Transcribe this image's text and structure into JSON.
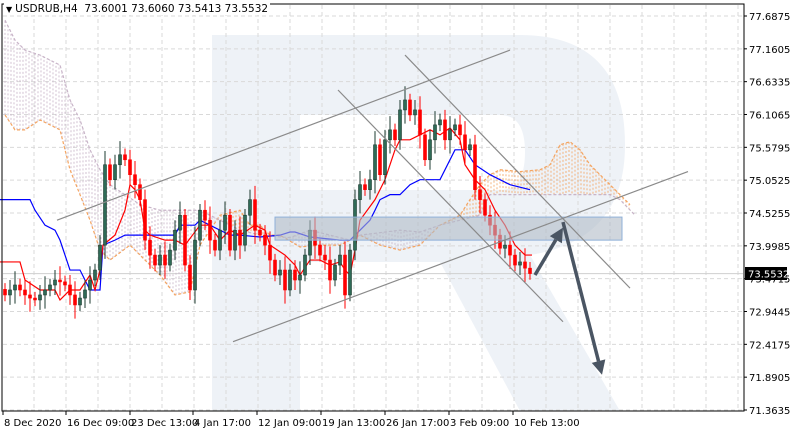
{
  "header": {
    "symbol": "USDRUB,H4",
    "ohlc": "73.6001 73.6060 73.5413 73.5532",
    "menu_icon": "triangle-down-icon"
  },
  "colors": {
    "bull": "#2f6b57",
    "bear": "#ff0000",
    "tenkan": "#ff0000",
    "kijun": "#0000ff",
    "span_a": "#f4a460",
    "span_b": "#c8b4c8",
    "grid": "#d9d9d9",
    "drawing": "#8a8a8a",
    "arrow": "#4a5563",
    "zone": "#b0bac6",
    "price_tag": "#000000"
  },
  "chart_data": {
    "type": "candlestick",
    "title": "USDRUB,H4",
    "ylim": [
      71.3635,
      77.6875
    ],
    "y_ticks": [
      "77.6875",
      "77.1605",
      "76.6335",
      "76.1065",
      "75.5795",
      "75.0525",
      "74.5255",
      "73.9985",
      "73.4715",
      "72.9445",
      "72.4175",
      "71.8905",
      "71.3635"
    ],
    "x_ticks": [
      {
        "bar": -0.4,
        "label": "8 Dec 2020"
      },
      {
        "bar": 12.2,
        "label": "16 Dec 09:00"
      },
      {
        "bar": 25,
        "label": "23 Dec 13:00"
      },
      {
        "bar": 37.6,
        "label": "4 Jan 17:00"
      },
      {
        "bar": 50.4,
        "label": "12 Jan 09:00"
      },
      {
        "bar": 63.2,
        "label": "19 Jan 13:00"
      },
      {
        "bar": 76,
        "label": "26 Jan 17:00"
      },
      {
        "bar": 88.8,
        "label": "3 Feb 09:00"
      },
      {
        "bar": 101.6,
        "label": "10 Feb 13:00"
      }
    ],
    "current_price": "73.5532",
    "first_open": 73.3,
    "wick": 0.1,
    "closes": [
      73.21,
      73.29,
      73.37,
      73.29,
      73.21,
      73.16,
      73.13,
      73.21,
      73.29,
      73.37,
      73.45,
      73.42,
      73.37,
      73.21,
      73.05,
      73.16,
      73.29,
      73.45,
      73.61,
      74.01,
      75.3,
      75.06,
      75.3,
      75.46,
      75.38,
      75.14,
      74.98,
      74.74,
      74.09,
      73.85,
      73.69,
      73.85,
      73.69,
      73.93,
      74.25,
      74.49,
      73.69,
      73.29,
      74.09,
      74.57,
      74.41,
      74.09,
      73.93,
      74.25,
      74.49,
      73.93,
      74.25,
      74.01,
      74.49,
      74.74,
      74.25,
      74.17,
      74.01,
      73.77,
      73.53,
      73.61,
      73.29,
      73.61,
      73.45,
      73.53,
      73.85,
      74.25,
      74.01,
      73.85,
      73.77,
      73.45,
      73.69,
      73.85,
      73.21,
      73.93,
      74.74,
      74.98,
      74.9,
      75.06,
      75.62,
      75.14,
      75.7,
      75.86,
      75.7,
      76.18,
      76.34,
      76.1,
      76.18,
      75.78,
      75.38,
      75.7,
      75.94,
      76.02,
      75.7,
      75.86,
      75.94,
      75.78,
      75.54,
      75.62,
      74.9,
      74.74,
      74.49,
      74.33,
      74.17,
      73.96,
      74.01,
      73.85,
      73.69,
      73.74,
      73.64,
      73.5532
    ],
    "indicators": {
      "tenkan": [
        [
          -1,
          73.74
        ],
        [
          3,
          73.74
        ],
        [
          4,
          73.45
        ],
        [
          7,
          73.29
        ],
        [
          10,
          73.29
        ],
        [
          11,
          73.13
        ],
        [
          13,
          73.29
        ],
        [
          15,
          73.29
        ],
        [
          17,
          73.53
        ],
        [
          18,
          73.29
        ],
        [
          19,
          73.61
        ],
        [
          19.6,
          74.01
        ],
        [
          22,
          74.17
        ],
        [
          24,
          74.57
        ],
        [
          25,
          74.98
        ],
        [
          26,
          74.9
        ],
        [
          27,
          74.74
        ],
        [
          28,
          74.25
        ],
        [
          29,
          74.17
        ],
        [
          32,
          74.09
        ],
        [
          34,
          74.09
        ],
        [
          36,
          74.01
        ],
        [
          39,
          74.33
        ],
        [
          41,
          74.33
        ],
        [
          43,
          74.09
        ],
        [
          45,
          74.25
        ],
        [
          47,
          74.17
        ],
        [
          50,
          74.33
        ],
        [
          52,
          74.25
        ],
        [
          53,
          74.01
        ],
        [
          56,
          73.85
        ],
        [
          58,
          73.69
        ],
        [
          59,
          73.53
        ],
        [
          61,
          73.77
        ],
        [
          63,
          73.77
        ],
        [
          65,
          73.69
        ],
        [
          67,
          73.74
        ],
        [
          68,
          73.61
        ],
        [
          69,
          73.53
        ],
        [
          70,
          73.93
        ],
        [
          71,
          74.41
        ],
        [
          74,
          74.74
        ],
        [
          76,
          75.06
        ],
        [
          77,
          75.3
        ],
        [
          78,
          75.54
        ],
        [
          79,
          75.7
        ],
        [
          81,
          75.7
        ],
        [
          83,
          75.78
        ],
        [
          85,
          75.86
        ],
        [
          87,
          75.78
        ],
        [
          89,
          75.89
        ],
        [
          91,
          75.7
        ],
        [
          92,
          75.3
        ],
        [
          94,
          75.06
        ],
        [
          96,
          74.9
        ],
        [
          98,
          74.57
        ],
        [
          100,
          74.33
        ],
        [
          102,
          74.01
        ],
        [
          104,
          73.85
        ],
        [
          105.4,
          73.85
        ]
      ],
      "kijun": [
        [
          -1,
          74.74
        ],
        [
          5,
          74.74
        ],
        [
          6,
          74.57
        ],
        [
          8,
          74.33
        ],
        [
          10,
          74.25
        ],
        [
          11,
          74.09
        ],
        [
          12,
          73.85
        ],
        [
          13,
          73.61
        ],
        [
          15,
          73.61
        ],
        [
          17,
          73.29
        ],
        [
          19,
          73.29
        ],
        [
          19.6,
          74.01
        ],
        [
          22,
          74.09
        ],
        [
          24,
          74.17
        ],
        [
          34,
          74.17
        ],
        [
          35,
          74.33
        ],
        [
          38,
          74.33
        ],
        [
          39,
          74.41
        ],
        [
          45,
          74.17
        ],
        [
          47,
          74.17
        ],
        [
          51,
          74.14
        ],
        [
          55,
          74.17
        ],
        [
          57,
          74.22
        ],
        [
          58,
          74.22
        ],
        [
          61,
          74.14
        ],
        [
          67,
          74.09
        ],
        [
          69,
          74.09
        ],
        [
          71,
          74.25
        ],
        [
          73,
          74.41
        ],
        [
          74,
          74.57
        ],
        [
          75,
          74.74
        ],
        [
          77,
          74.82
        ],
        [
          79,
          74.82
        ],
        [
          81,
          74.98
        ],
        [
          83,
          75.06
        ],
        [
          87,
          75.06
        ],
        [
          90,
          75.54
        ],
        [
          92,
          75.54
        ],
        [
          94,
          75.3
        ],
        [
          97,
          75.14
        ],
        [
          101,
          74.98
        ],
        [
          105,
          74.9
        ]
      ],
      "span_a": [
        [
          0,
          76.1
        ],
        [
          2,
          75.86
        ],
        [
          4,
          75.86
        ],
        [
          7,
          76.02
        ],
        [
          11,
          75.86
        ],
        [
          13,
          75.22
        ],
        [
          15,
          74.82
        ],
        [
          17,
          74.41
        ],
        [
          19,
          73.93
        ],
        [
          21,
          73.77
        ],
        [
          25,
          74.01
        ],
        [
          28,
          73.77
        ],
        [
          31,
          73.53
        ],
        [
          34,
          73.21
        ],
        [
          37,
          73.26
        ],
        [
          39,
          74.01
        ],
        [
          41,
          74.25
        ],
        [
          43,
          74.49
        ],
        [
          47,
          74.57
        ],
        [
          49,
          74.33
        ],
        [
          51,
          74.33
        ],
        [
          53,
          74.17
        ],
        [
          55,
          74.17
        ],
        [
          59,
          73.98
        ],
        [
          63,
          74.01
        ],
        [
          67,
          74.01
        ],
        [
          69,
          74.09
        ],
        [
          71,
          74.17
        ],
        [
          75,
          74.01
        ],
        [
          79,
          73.93
        ],
        [
          83,
          74.01
        ],
        [
          87,
          74.33
        ],
        [
          91,
          74.49
        ],
        [
          93,
          74.74
        ],
        [
          95,
          74.98
        ],
        [
          97,
          75.14
        ],
        [
          99,
          75.22
        ],
        [
          103,
          75.19
        ],
        [
          107,
          75.22
        ],
        [
          109,
          75.3
        ],
        [
          111,
          75.62
        ],
        [
          113,
          75.67
        ],
        [
          115,
          75.54
        ],
        [
          117,
          75.3
        ],
        [
          119,
          75.14
        ],
        [
          121,
          74.98
        ],
        [
          123,
          74.82
        ],
        [
          125,
          74.66
        ]
      ],
      "span_b": [
        [
          0,
          77.62
        ],
        [
          2,
          77.3
        ],
        [
          4,
          77.14
        ],
        [
          7,
          77.06
        ],
        [
          11,
          76.9
        ],
        [
          13,
          76.34
        ],
        [
          15,
          76.02
        ],
        [
          17,
          75.54
        ],
        [
          19,
          75.22
        ],
        [
          21,
          74.98
        ],
        [
          24,
          74.82
        ],
        [
          27,
          74.66
        ],
        [
          31,
          74.57
        ],
        [
          39,
          74.57
        ],
        [
          43,
          74.41
        ],
        [
          47,
          74.25
        ],
        [
          51,
          74.17
        ],
        [
          57,
          74.13
        ],
        [
          61,
          74.25
        ],
        [
          65,
          74.17
        ],
        [
          69,
          74.09
        ],
        [
          71,
          74.17
        ],
        [
          79,
          74.25
        ],
        [
          83,
          74.22
        ],
        [
          87,
          74.33
        ],
        [
          91,
          74.41
        ],
        [
          95,
          74.49
        ],
        [
          97,
          74.82
        ],
        [
          121,
          74.82
        ],
        [
          123,
          74.74
        ],
        [
          126,
          74.49
        ]
      ]
    },
    "drawings": {
      "channel_upper": [
        [
          10.4,
          74.41
        ],
        [
          101,
          77.14
        ]
      ],
      "channel_lower": [
        [
          45.6,
          72.46
        ],
        [
          136.6,
          75.19
        ]
      ],
      "down_line_1": [
        [
          66.6,
          76.5
        ],
        [
          111.6,
          72.78
        ]
      ],
      "down_line_2": [
        [
          80,
          77.06
        ],
        [
          125,
          73.32
        ]
      ],
      "zone": {
        "from_bar": 54,
        "to_bar": 123.4,
        "top": 74.46,
        "bottom": 74.09
      },
      "arrow_up": [
        [
          106,
          73.53
        ],
        [
          111.6,
          74.29
        ]
      ],
      "arrow_down": [
        [
          111.6,
          74.38
        ],
        [
          119.4,
          71.93
        ]
      ]
    }
  }
}
